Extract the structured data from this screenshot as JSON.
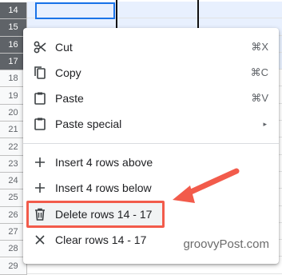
{
  "rows": [
    "14",
    "15",
    "16",
    "17",
    "18",
    "19",
    "20",
    "21",
    "22",
    "23",
    "24",
    "25",
    "26",
    "27",
    "28",
    "29"
  ],
  "selected_rows": [
    "14",
    "15",
    "16",
    "17"
  ],
  "menu": {
    "items": [
      {
        "name": "cut",
        "label": "Cut",
        "shortcut": "⌘X",
        "icon": "scissors-icon"
      },
      {
        "name": "copy",
        "label": "Copy",
        "shortcut": "⌘C",
        "icon": "copy-icon"
      },
      {
        "name": "paste",
        "label": "Paste",
        "shortcut": "⌘V",
        "icon": "clipboard-icon"
      },
      {
        "name": "paste-special",
        "label": "Paste special",
        "icon": "clipboard-icon",
        "submenu_arrow": "▸"
      },
      {
        "name": "insert-above",
        "label": "Insert 4 rows above",
        "icon": "plus-icon"
      },
      {
        "name": "insert-below",
        "label": "Insert 4 rows below",
        "icon": "plus-icon"
      },
      {
        "name": "delete-rows",
        "label": "Delete rows 14 - 17",
        "icon": "trash-icon"
      },
      {
        "name": "clear-rows",
        "label": "Clear rows 14 - 17",
        "icon": "close-icon"
      }
    ]
  },
  "watermark": "groovyPost.com",
  "colors": {
    "accent": "#1a73e8",
    "highlight": "#f25b4b",
    "selected_header": "#5f6368"
  }
}
